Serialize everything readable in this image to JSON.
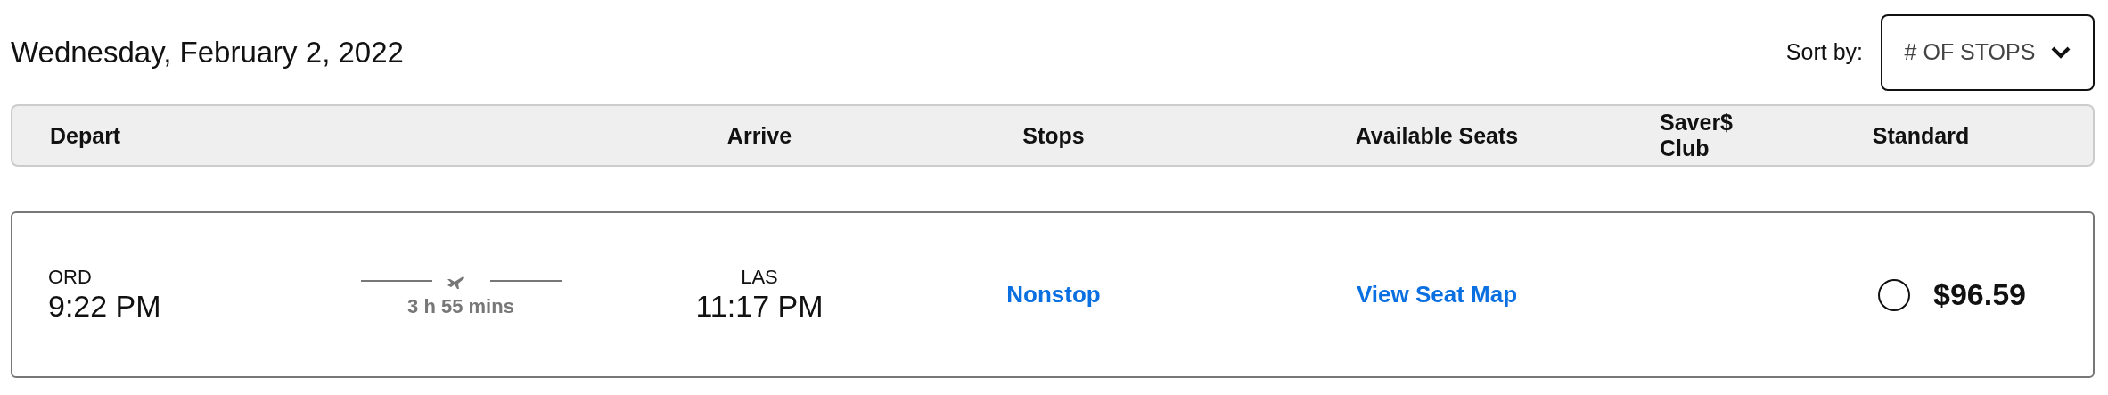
{
  "date": "Wednesday, February 2, 2022",
  "sort": {
    "label": "Sort by:",
    "value": "# OF STOPS"
  },
  "columns": [
    "Depart",
    "Arrive",
    "Stops",
    "Available Seats",
    "Saver$ Club",
    "Standard"
  ],
  "flights": [
    {
      "origin": "ORD",
      "depart_time": "9:22 PM",
      "duration": "3 h 55 mins",
      "destination": "LAS",
      "arrive_time": "11:17 PM",
      "stops": "Nonstop",
      "seats_link": "View Seat Map",
      "standard_price": "$96.59",
      "standard_selected": false
    }
  ]
}
